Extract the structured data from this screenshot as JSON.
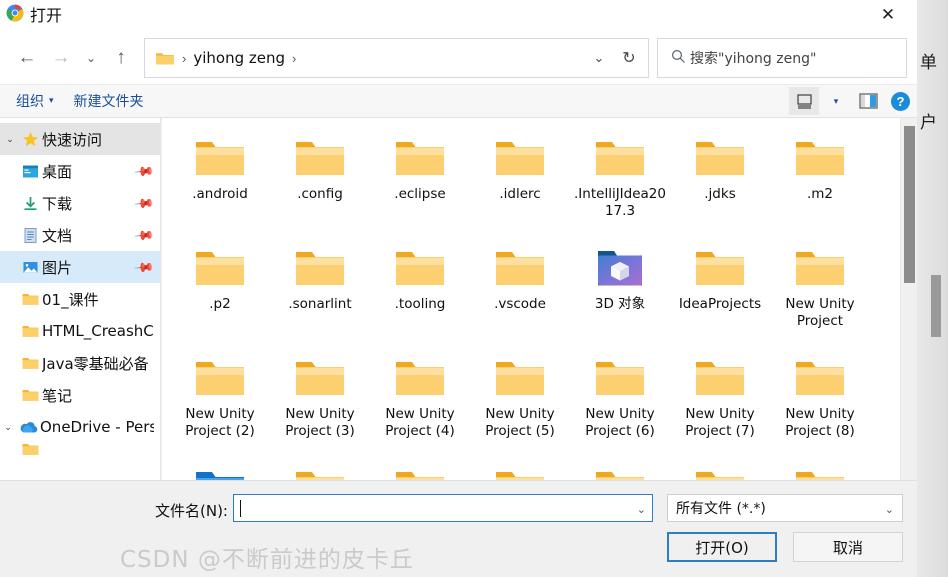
{
  "window": {
    "title": "打开",
    "app_icon": "chrome-icon",
    "close_label": "✕"
  },
  "navbar": {
    "back_label": "←",
    "forward_label": "→",
    "recent_label": "⌄",
    "up_label": "↑",
    "address": {
      "folder_icon": "folder-icon",
      "separator": "›",
      "crumb": "yihong zeng",
      "dropdown_label": "⌄",
      "refresh_label": "↻"
    },
    "search": {
      "icon": "search-icon",
      "placeholder": "搜索\"yihong zeng\""
    }
  },
  "toolbar": {
    "organize_label": "组织",
    "organize_caret": "▾",
    "new_folder_label": "新建文件夹",
    "view_icon": "view-layout-icon",
    "view_caret": "▾",
    "preview_icon": "preview-pane-icon",
    "help_icon": "help-icon",
    "help_label": "?"
  },
  "sidebar": {
    "items": [
      {
        "label": "快速访问",
        "icon": "star-icon",
        "type": "group",
        "chevron": "⌄",
        "selected": false,
        "pinned": false
      },
      {
        "label": "桌面",
        "icon": "desktop-icon",
        "type": "child",
        "selected": false,
        "pinned": true
      },
      {
        "label": "下载",
        "icon": "downloads-icon",
        "type": "child",
        "selected": false,
        "pinned": true
      },
      {
        "label": "文档",
        "icon": "documents-icon",
        "type": "child",
        "selected": false,
        "pinned": true
      },
      {
        "label": "图片",
        "icon": "pictures-icon",
        "type": "child",
        "selected": true,
        "pinned": true
      },
      {
        "label": "01_课件",
        "icon": "folder-icon",
        "type": "child",
        "selected": false,
        "pinned": false
      },
      {
        "label": "HTML_CreashC",
        "icon": "folder-icon",
        "type": "child",
        "selected": false,
        "pinned": false
      },
      {
        "label": "Java零基础必备",
        "icon": "folder-icon",
        "type": "child",
        "selected": false,
        "pinned": false
      },
      {
        "label": "笔记",
        "icon": "folder-icon",
        "type": "child",
        "selected": false,
        "pinned": false
      },
      {
        "label": "OneDrive - Perso",
        "icon": "onedrive-icon",
        "type": "group",
        "chevron": "⌄",
        "selected": false,
        "pinned": false
      }
    ]
  },
  "files": {
    "items": [
      {
        "name": ".android",
        "icon": "folder-icon"
      },
      {
        "name": ".config",
        "icon": "folder-icon"
      },
      {
        "name": ".eclipse",
        "icon": "folder-icon"
      },
      {
        "name": ".idlerc",
        "icon": "folder-icon"
      },
      {
        "name": ".IntelliJIdea2017.3",
        "icon": "folder-icon"
      },
      {
        "name": ".jdks",
        "icon": "folder-icon"
      },
      {
        "name": ".m2",
        "icon": "folder-icon"
      },
      {
        "name": ".p2",
        "icon": "folder-icon"
      },
      {
        "name": ".sonarlint",
        "icon": "folder-icon"
      },
      {
        "name": ".tooling",
        "icon": "folder-icon"
      },
      {
        "name": ".vscode",
        "icon": "folder-icon"
      },
      {
        "name": "3D 对象",
        "icon": "3d-objects-icon"
      },
      {
        "name": "IdeaProjects",
        "icon": "folder-icon"
      },
      {
        "name": "New Unity Project",
        "icon": "folder-icon"
      },
      {
        "name": "New Unity Project (2)",
        "icon": "folder-icon"
      },
      {
        "name": "New Unity Project (3)",
        "icon": "folder-icon"
      },
      {
        "name": "New Unity Project (4)",
        "icon": "folder-icon"
      },
      {
        "name": "New Unity Project (5)",
        "icon": "folder-icon"
      },
      {
        "name": "New Unity Project (6)",
        "icon": "folder-icon"
      },
      {
        "name": "New Unity Project (7)",
        "icon": "folder-icon"
      },
      {
        "name": "New Unity Project (8)",
        "icon": "folder-icon"
      },
      {
        "name": "",
        "icon": "blue-folder-icon"
      },
      {
        "name": "",
        "icon": "folder-icon"
      },
      {
        "name": "",
        "icon": "folder-icon"
      },
      {
        "name": "",
        "icon": "folder-icon"
      },
      {
        "name": "",
        "icon": "folder-icon"
      },
      {
        "name": "",
        "icon": "folder-icon"
      },
      {
        "name": "",
        "icon": "folder-icon"
      }
    ]
  },
  "bottom": {
    "filename_label": "文件名(N):",
    "filename_value": "",
    "filetype_value": "所有文件 (*.*)",
    "filetype_chevron": "⌄",
    "open_button": "打开(O)",
    "cancel_button": "取消"
  },
  "watermark": "CSDN @不断前进的皮卡丘",
  "background_window": {
    "text_1": "单",
    "text_2": "户"
  },
  "colors": {
    "accent": "#2e7cc4",
    "folder": "#f8c650",
    "selection": "#d7eaf9",
    "toolbar_link": "#1b4f9c"
  }
}
